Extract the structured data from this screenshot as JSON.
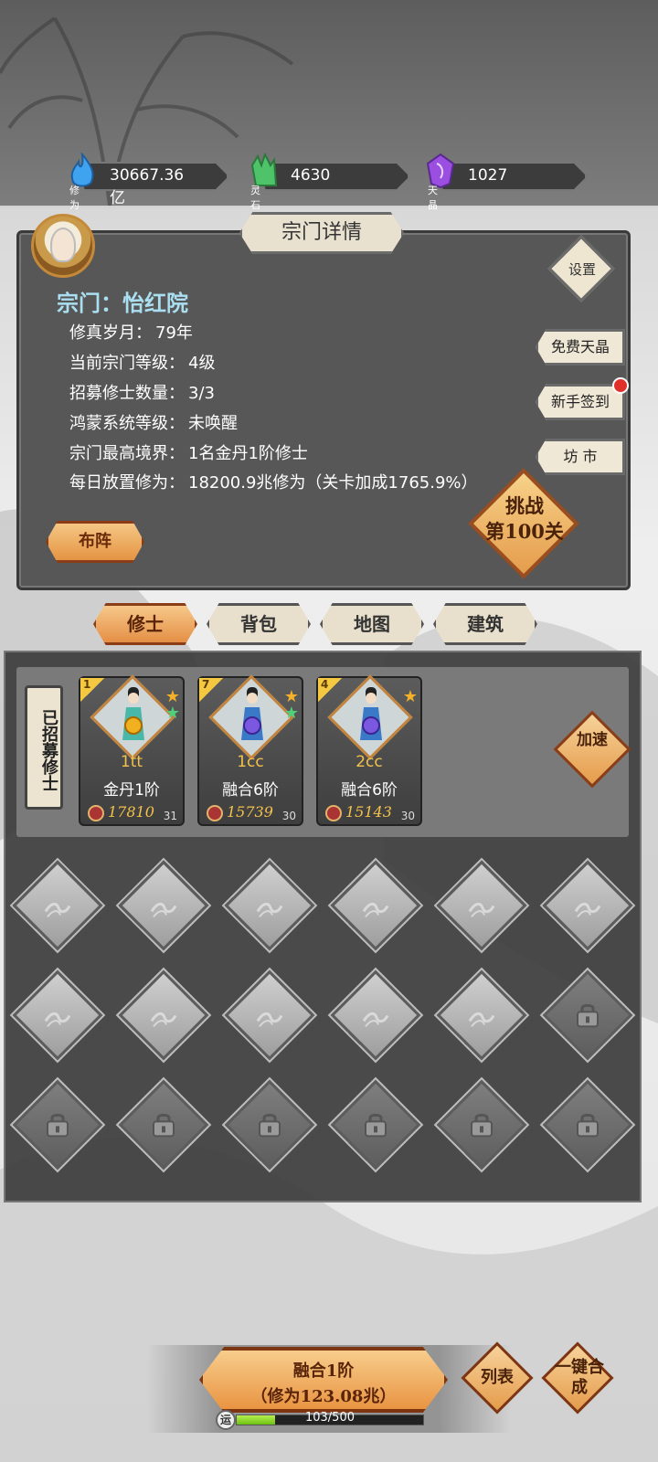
{
  "resources": [
    {
      "label": "修为",
      "value": "30667.36亿",
      "icon": "blue-flame-icon",
      "color": "#3fa3f0"
    },
    {
      "label": "灵石",
      "value": "4630",
      "icon": "green-crystal-icon",
      "color": "#4fc36a"
    },
    {
      "label": "天晶",
      "value": "1027",
      "icon": "purple-crystal-icon",
      "color": "#9b4fe0"
    }
  ],
  "panel": {
    "title": "宗门详情",
    "sect_name": "宗门：怡红院",
    "info": [
      {
        "key": "修真岁月：",
        "value": "79年"
      },
      {
        "key": "当前宗门等级：",
        "value": "4级"
      },
      {
        "key": "招募修士数量：",
        "value": "3/3"
      },
      {
        "key": "鸿蒙系统等级：",
        "value": "未唤醒"
      },
      {
        "key": "宗门最高境界：",
        "value": "1名金丹1阶修士"
      },
      {
        "key": "每日放置修为：",
        "value": "18200.9兆修为（关卡加成1765.9%）"
      }
    ],
    "settings": "设置",
    "side_buttons": [
      "免费天晶",
      "新手签到",
      "坊 市"
    ],
    "challenge_line1": "挑战",
    "challenge_line2": "第100关",
    "formation": "布阵"
  },
  "tabs": [
    {
      "label": "修士",
      "active": true
    },
    {
      "label": "背包",
      "active": false
    },
    {
      "label": "地图",
      "active": false
    },
    {
      "label": "建筑",
      "active": false
    }
  ],
  "recruit_label": "已招募修士",
  "cultivators": [
    {
      "badge": "1",
      "name": "1tt",
      "realm": "金丹1阶",
      "power": "17810",
      "level": "31",
      "stars": [
        "gold",
        "green"
      ],
      "orb_color": "#f0b020",
      "robe_color": "#49b8a8"
    },
    {
      "badge": "7",
      "name": "1cc",
      "realm": "融合6阶",
      "power": "15739",
      "level": "30",
      "stars": [
        "gold",
        "green"
      ],
      "orb_color": "#7a58e0",
      "robe_color": "#3a78c8"
    },
    {
      "badge": "4",
      "name": "2cc",
      "realm": "融合6阶",
      "power": "15143",
      "level": "30",
      "stars": [
        "gold"
      ],
      "orb_color": "#7a58e0",
      "robe_color": "#3a78c8"
    }
  ],
  "speed_label": "加速",
  "slots": {
    "empty_count": 11,
    "locked_count": 7
  },
  "bottom": {
    "merge_line1": "融合1阶",
    "merge_line2": "（修为123.08兆）",
    "list_btn": "列表",
    "one_key_btn": "一键合成",
    "luck_icon_text": "运",
    "progress_text": "103/500",
    "progress_value": 0.206
  }
}
